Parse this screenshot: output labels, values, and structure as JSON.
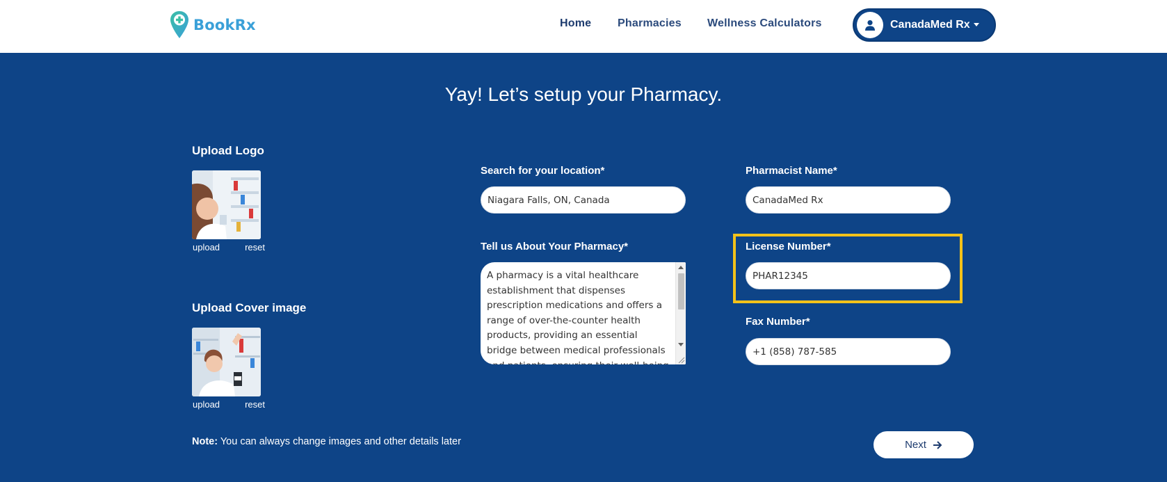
{
  "header": {
    "logo_text": "BookRx",
    "nav": {
      "home": "Home",
      "pharmacies": "Pharmacies",
      "wellness": "Wellness Calculators"
    },
    "user_label": "CanadaMed Rx",
    "colors": {
      "brand_blue": "#3aa0d8",
      "brand_teal": "#3bbfa5",
      "nav_text": "#1d3b6e",
      "user_button": "#0e4487"
    }
  },
  "page": {
    "title": "Yay! Let’s setup your Pharmacy.",
    "background": "#0e4487"
  },
  "uploads": {
    "logo": {
      "label": "Upload Logo",
      "upload": "upload",
      "reset": "reset"
    },
    "cover": {
      "label": "Upload Cover image",
      "upload": "upload",
      "reset": "reset"
    }
  },
  "form": {
    "location": {
      "label": "Search for your location*",
      "value": "Niagara Falls, ON, Canada"
    },
    "about": {
      "label": "Tell us About Your Pharmacy*",
      "value": "A pharmacy is a vital healthcare establishment that dispenses prescription medications and offers a range of over-the-counter health products, providing an essential bridge between medical professionals and patients, ensuring their well-being and"
    },
    "pharmacist": {
      "label": "Pharmacist Name*",
      "value": "CanadaMed Rx"
    },
    "license": {
      "label": "License Number*",
      "value": "PHAR12345"
    },
    "fax": {
      "label": "Fax Number*",
      "value": "+1 (858) 787-585"
    }
  },
  "footer": {
    "note_bold": "Note:",
    "note_text": " You can always change images and other details later",
    "next_label": "Next",
    "highlight_color": "#f3c21a"
  }
}
